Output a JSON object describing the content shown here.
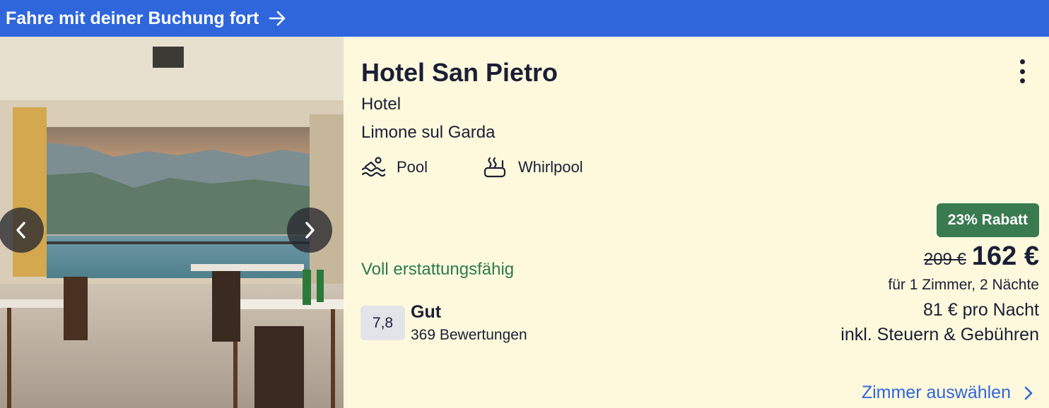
{
  "banner": {
    "label": "Fahre mit deiner Buchung fort",
    "arrow_icon": "arrow-right-icon"
  },
  "hotel": {
    "name": "Hotel San Pietro",
    "type": "Hotel",
    "location": "Limone sul Garda"
  },
  "amenities": [
    {
      "label": "Pool",
      "icon": "pool-icon"
    },
    {
      "label": "Whirlpool",
      "icon": "hot-tub-icon"
    }
  ],
  "refund_text": "Voll erstattungsfähig",
  "rating": {
    "score": "7,8",
    "label": "Gut",
    "count": "369 Bewertungen"
  },
  "pricing": {
    "discount": "23% Rabatt",
    "old_price": "209 €",
    "new_price": "162 €",
    "details": "für 1 Zimmer, 2 Nächte",
    "per_night": "81 € pro Nacht",
    "taxes": "inkl. Steuern & Gebühren"
  },
  "cta": {
    "label": "Zimmer auswählen",
    "icon": "chevron-right-icon"
  },
  "colors": {
    "brand_blue": "#2f66dc",
    "card_bg": "#fef9dc",
    "green": "#2d7a4b",
    "badge_green": "#3a7a50"
  }
}
